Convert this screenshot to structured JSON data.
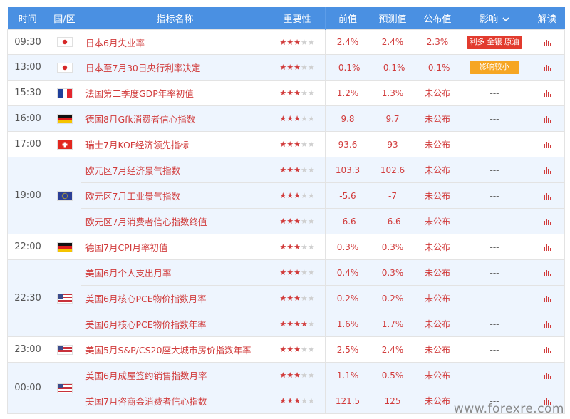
{
  "headers": {
    "time": "时间",
    "country": "国/区",
    "indicator": "指标名称",
    "importance": "重要性",
    "previous": "前值",
    "forecast": "预测值",
    "actual": "公布值",
    "impact": "影响",
    "analysis": "解读"
  },
  "colors": {
    "header_bg": "#4a90e2",
    "text_red": "#d13b3b",
    "badge_red": "#e23b2e",
    "badge_orange": "#f6a623",
    "highlight_row": "#eef5fe"
  },
  "groups": [
    {
      "time": "09:30",
      "rows": [
        {
          "flag": "japan-flag",
          "name": "日本6月失业率",
          "stars": 3,
          "previous": "2.4%",
          "forecast": "2.4%",
          "actual": "2.3%",
          "impact": "利多 金银 原油",
          "impact_style": "red"
        }
      ]
    },
    {
      "time": "13:00",
      "highlight": true,
      "rows": [
        {
          "flag": "japan-flag",
          "name": "日本至7月30日央行利率决定",
          "stars": 3,
          "previous": "-0.1%",
          "forecast": "-0.1%",
          "actual": "-0.1%",
          "impact": "影响较小",
          "impact_style": "orange"
        }
      ]
    },
    {
      "time": "15:30",
      "rows": [
        {
          "flag": "france-flag",
          "name": "法国第二季度GDP年率初值",
          "stars": 3,
          "previous": "1.2%",
          "forecast": "1.3%",
          "actual": "未公布",
          "impact": "---"
        }
      ]
    },
    {
      "time": "16:00",
      "highlight": true,
      "rows": [
        {
          "flag": "germany-flag",
          "name": "德国8月Gfk消费者信心指数",
          "stars": 3,
          "previous": "9.8",
          "forecast": "9.7",
          "actual": "未公布",
          "impact": "---"
        }
      ]
    },
    {
      "time": "17:00",
      "rows": [
        {
          "flag": "switzerland-flag",
          "name": "瑞士7月KOF经济领先指标",
          "stars": 3,
          "previous": "93.6",
          "forecast": "93",
          "actual": "未公布",
          "impact": "---"
        }
      ]
    },
    {
      "time": "19:00",
      "highlight": true,
      "rows": [
        {
          "flag": "eu-flag",
          "name": "欧元区7月经济景气指数",
          "stars": 3,
          "previous": "103.3",
          "forecast": "102.6",
          "actual": "未公布",
          "impact": "---"
        },
        {
          "name": "欧元区7月工业景气指数",
          "stars": 3,
          "previous": "-5.6",
          "forecast": "-7",
          "actual": "未公布",
          "impact": "---"
        },
        {
          "name": "欧元区7月消费者信心指数终值",
          "stars": 3,
          "previous": "-6.6",
          "forecast": "-6.6",
          "actual": "未公布",
          "impact": "---"
        }
      ]
    },
    {
      "time": "22:00",
      "rows": [
        {
          "flag": "germany-flag",
          "name": "德国7月CPI月率初值",
          "stars": 3,
          "previous": "0.3%",
          "forecast": "0.3%",
          "actual": "未公布",
          "impact": "---"
        }
      ]
    },
    {
      "time": "22:30",
      "highlight": true,
      "rows": [
        {
          "flag": "usa-flag",
          "name": "美国6月个人支出月率",
          "stars": 3,
          "previous": "0.4%",
          "forecast": "0.3%",
          "actual": "未公布",
          "impact": "---"
        },
        {
          "name": "美国6月核心PCE物价指数月率",
          "stars": 3,
          "previous": "0.2%",
          "forecast": "0.2%",
          "actual": "未公布",
          "impact": "---"
        },
        {
          "name": "美国6月核心PCE物价指数年率",
          "stars": 4,
          "previous": "1.6%",
          "forecast": "1.7%",
          "actual": "未公布",
          "impact": "---"
        }
      ]
    },
    {
      "time": "23:00",
      "rows": [
        {
          "flag": "usa-flag",
          "name": "美国5月S&P/CS20座大城市房价指数年率",
          "stars": 3,
          "previous": "2.5%",
          "forecast": "2.4%",
          "actual": "未公布",
          "impact": "---"
        }
      ]
    },
    {
      "time": "00:00",
      "highlight": true,
      "rows": [
        {
          "flag": "usa-flag",
          "name": "美国6月成屋签约销售指数月率",
          "stars": 3,
          "previous": "1.1%",
          "forecast": "0.5%",
          "actual": "未公布",
          "impact": "---"
        },
        {
          "name": "美国7月咨商会消费者信心指数",
          "stars": 3,
          "previous": "121.5",
          "forecast": "125",
          "actual": "未公布",
          "impact": "---"
        }
      ]
    }
  ],
  "watermark": "www.forexre.com"
}
